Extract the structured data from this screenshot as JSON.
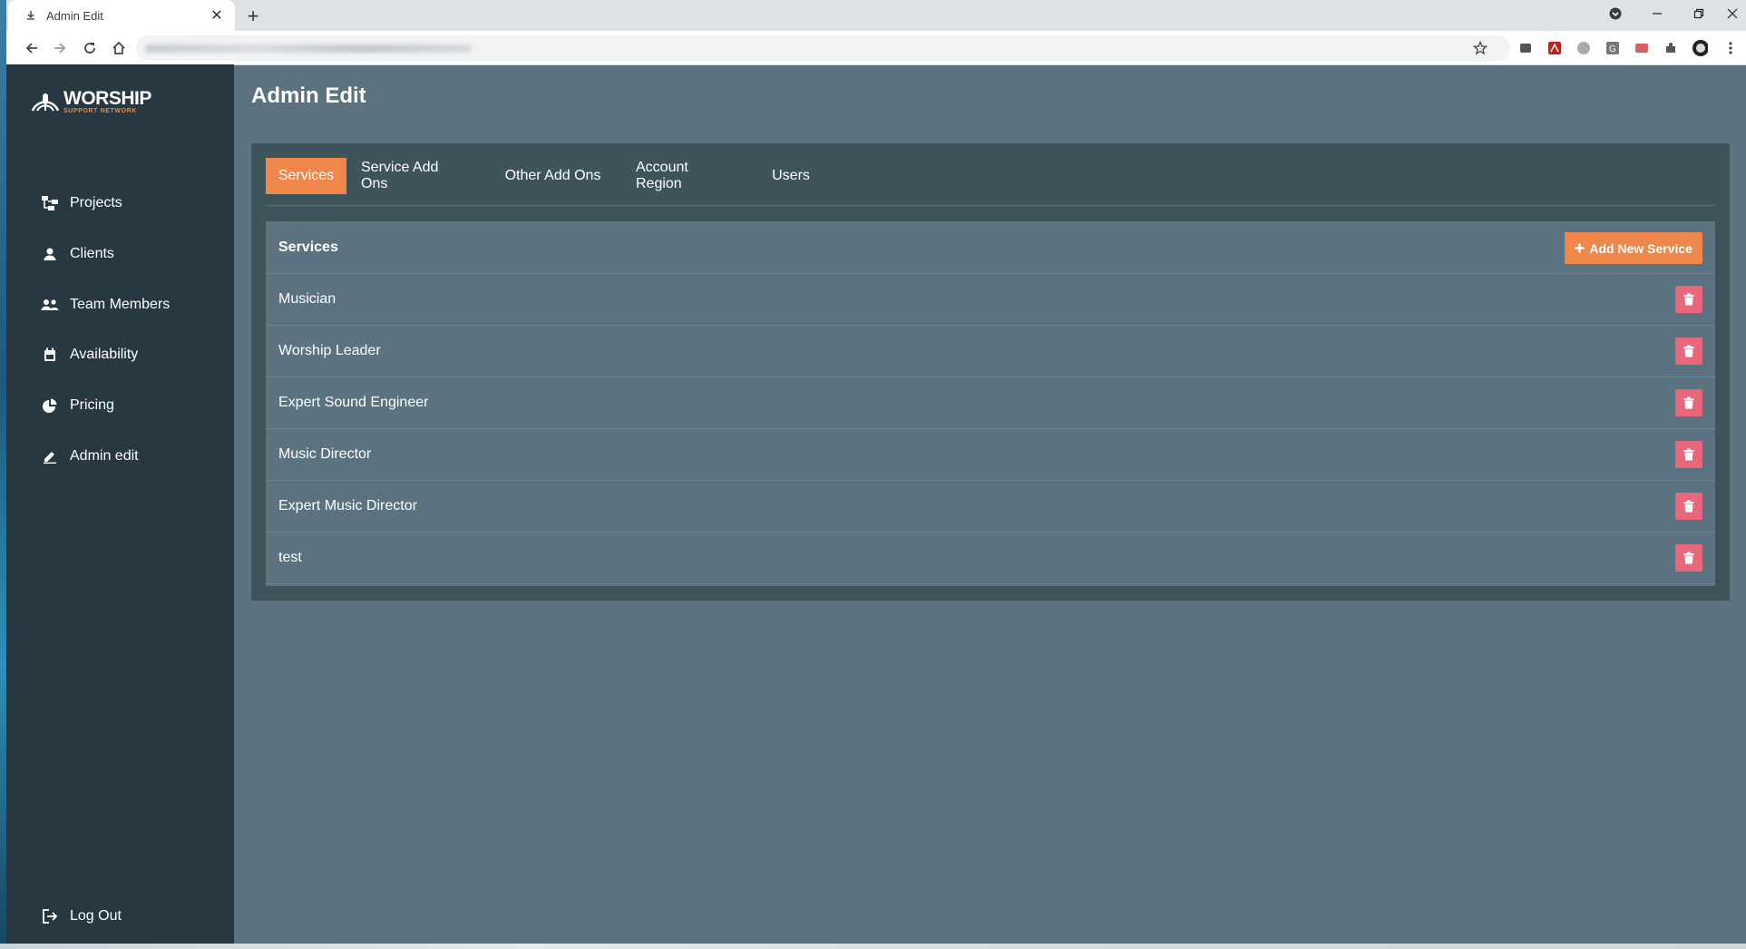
{
  "browser": {
    "tab_title": "Admin Edit",
    "new_tab_label": "+"
  },
  "app": {
    "logo_word": "WORSHIP",
    "logo_sub": "SUPPORT NETWORK",
    "accent": "#f0874a"
  },
  "sidebar": {
    "items": [
      {
        "label": "Projects",
        "icon": "hierarchy-icon"
      },
      {
        "label": "Clients",
        "icon": "person-icon"
      },
      {
        "label": "Team Members",
        "icon": "people-icon"
      },
      {
        "label": "Availability",
        "icon": "calendar-icon"
      },
      {
        "label": "Pricing",
        "icon": "pie-chart-icon"
      },
      {
        "label": "Admin edit",
        "icon": "pencil-icon"
      }
    ],
    "logout_label": "Log Out"
  },
  "page": {
    "title": "Admin Edit"
  },
  "tabs": [
    "Services",
    "Service Add Ons",
    "Other Add Ons",
    "Account Region",
    "Users"
  ],
  "services": {
    "heading": "Services",
    "add_button": "Add New Service",
    "rows": [
      "Musician",
      "Worship Leader",
      "Expert Sound Engineer",
      "Music Director",
      "Expert Music Director",
      "test"
    ]
  }
}
